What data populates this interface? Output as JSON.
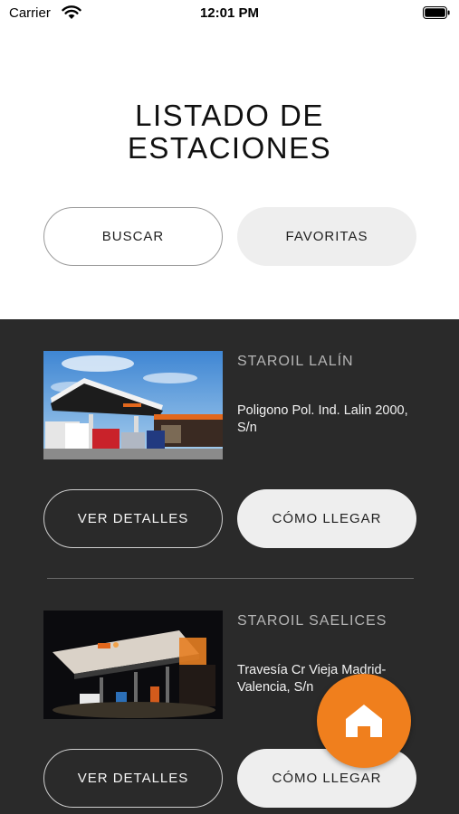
{
  "status_bar": {
    "carrier": "Carrier",
    "time": "12:01 PM",
    "icons": [
      "wifi-icon",
      "battery-icon"
    ]
  },
  "page": {
    "title_line1": "LISTADO DE",
    "title_line2": "ESTACIONES"
  },
  "filter": {
    "search_label": "BUSCAR",
    "favorites_label": "FAVORITAS"
  },
  "stations": [
    {
      "name": "STAROIL LALÍN",
      "address": "Poligono Pol. Ind. Lalin 2000, S/n",
      "details_label": "VER DETALLES",
      "directions_label": "CÓMO LLEGAR"
    },
    {
      "name": "STAROIL SAELICES",
      "address": "Travesía Cr Vieja Madrid-Valencia, S/n",
      "details_label": "VER DETALLES",
      "directions_label": "CÓMO LLEGAR"
    }
  ],
  "fab": {
    "icon": "home-icon"
  },
  "colors": {
    "panel_bg": "#2a2a2a",
    "accent": "#f07f1d",
    "button_light": "#eeeeee"
  }
}
